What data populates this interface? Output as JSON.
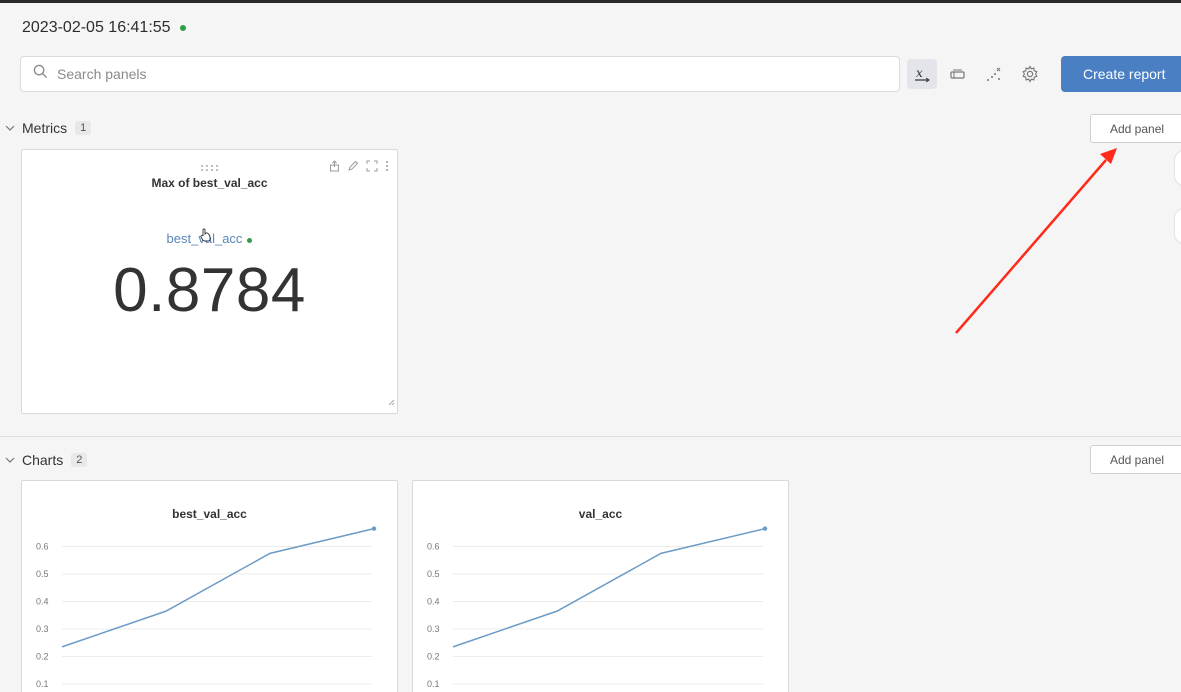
{
  "run": {
    "timestamp": "2023-02-05 16:41:55"
  },
  "search": {
    "placeholder": "Search panels",
    "value": ""
  },
  "toolbar": {
    "icons": [
      "x-axis-icon",
      "eraser-icon",
      "scatter-icon",
      "gear-icon"
    ],
    "create_report_label": "Create report"
  },
  "sections": {
    "metrics": {
      "title": "Metrics",
      "count": "1",
      "add_panel_label": "Add panel"
    },
    "charts": {
      "title": "Charts",
      "count": "2",
      "add_panel_label": "Add panel"
    }
  },
  "metric_panel": {
    "title": "Max of best_val_acc",
    "key": "best_val_acc",
    "value": "0.8784"
  },
  "colors": {
    "accent": "#4a7fc4",
    "line": "#6b9bc6",
    "status": "#2f9e44",
    "annotation": "#ff2a1a"
  },
  "chart_data": [
    {
      "type": "line",
      "title": "best_val_acc",
      "x": [
        0,
        1,
        2,
        3
      ],
      "y": [
        0.235,
        0.365,
        0.575,
        0.665
      ],
      "yticks": [
        "0.1",
        "0.2",
        "0.3",
        "0.4",
        "0.5",
        "0.6"
      ],
      "ylim": [
        0.1,
        0.6
      ],
      "grid": true
    },
    {
      "type": "line",
      "title": "val_acc",
      "x": [
        0,
        1,
        2,
        3
      ],
      "y": [
        0.235,
        0.365,
        0.575,
        0.665
      ],
      "yticks": [
        "0.1",
        "0.2",
        "0.3",
        "0.4",
        "0.5",
        "0.6"
      ],
      "ylim": [
        0.1,
        0.6
      ],
      "grid": true
    }
  ]
}
